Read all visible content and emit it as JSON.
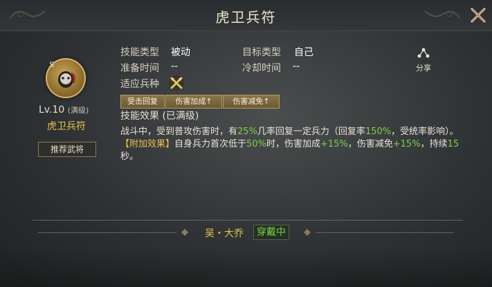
{
  "title": "虎卫兵符",
  "skill": {
    "grade_letter": "S",
    "level": "Lv.10",
    "level_note": "(满级)",
    "name": "虎卫兵符",
    "recommend_button": "推荐武将",
    "icon": "skill-emblem-icon"
  },
  "info": {
    "type_label": "技能类型",
    "type_value": "被动",
    "target_label": "目标类型",
    "target_value": "自己",
    "prep_label": "准备时间",
    "prep_value": "--",
    "cooldown_label": "冷却时间",
    "cooldown_value": "--",
    "troop_label": "适应兵种",
    "troop_icon": "crossed-weapons-icon"
  },
  "share": {
    "label": "分享",
    "icon": "share-icon"
  },
  "tags": [
    "受击回复",
    "伤害加成↑",
    "伤害减免↑"
  ],
  "effect_title": "技能效果 (已满级)",
  "description": {
    "p1_a": "战斗中，受到普攻伤害时，有",
    "p1_num1": "25%",
    "p1_b": "几率回复一定兵力（回复率",
    "p1_num2": "150%",
    "p1_c": "，受统率影响）。",
    "p2_tag": "【附加效果】",
    "p2_a": "自身兵力首次低于",
    "p2_num1": "50%",
    "p2_b": "时，伤害加成",
    "p2_num2": "+15%",
    "p2_c": "，伤害减免",
    "p2_num3": "+15%",
    "p2_d": "，持续",
    "p2_num4": "15",
    "p2_e": "秒。"
  },
  "bottom": {
    "general": "吴・大乔",
    "status": "穿戴中"
  },
  "colors": {
    "gold": "#e9c24a",
    "green": "#7bd14a",
    "tag_bg": "#7a6740"
  }
}
